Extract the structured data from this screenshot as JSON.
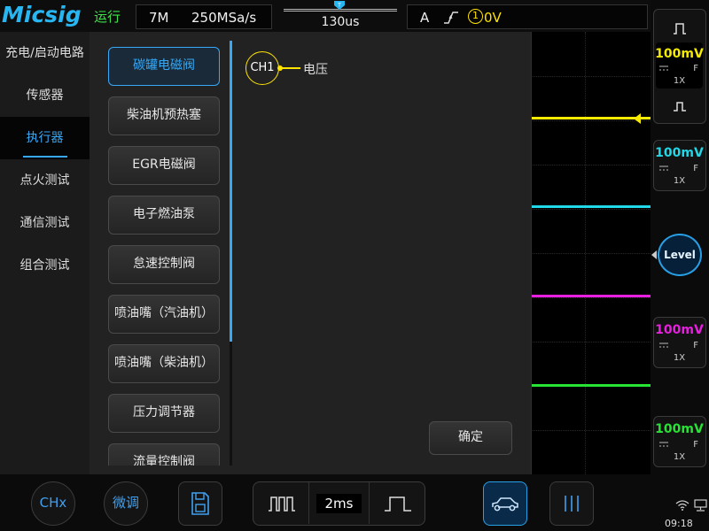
{
  "header": {
    "logo": "Micsig",
    "run_status": "运行",
    "memory_depth": "7M",
    "sample_rate": "250MSa/s",
    "trigger_delay": "130us",
    "trigger_mode": "A",
    "trigger_source": "1",
    "trigger_level": "0V",
    "trigger_edge_icon": "rising-edge-icon"
  },
  "channels": [
    {
      "id": "CH1",
      "scale": "100mV",
      "coupling": "DC",
      "bw": "F",
      "probe": "1X",
      "color": "#f5ea00"
    },
    {
      "id": "CH2",
      "scale": "100mV",
      "coupling": "DC",
      "bw": "F",
      "probe": "1X",
      "color": "#21d8e8"
    },
    {
      "id": "CH3",
      "scale": "100mV",
      "coupling": "DC",
      "bw": "F",
      "probe": "1X",
      "color": "#e81ee0"
    },
    {
      "id": "CH4",
      "scale": "100mV",
      "coupling": "DC",
      "bw": "F",
      "probe": "1X",
      "color": "#27e334"
    }
  ],
  "level_button": "Level",
  "dialog": {
    "categories": [
      "充电/启动电路",
      "传感器",
      "执行器",
      "点火测试",
      "通信测试",
      "组合测试"
    ],
    "active_category": "执行器",
    "items": [
      "碳罐电磁阀",
      "柴油机预热塞",
      "EGR电磁阀",
      "电子燃油泵",
      "怠速控制阀",
      "喷油嘴（汽油机）",
      "喷油嘴（柴油机）",
      "压力调节器",
      "流量控制阀"
    ],
    "active_item": "碳罐电磁阀",
    "detail": {
      "channel": "CH1",
      "signal": "电压"
    },
    "confirm_label": "确定"
  },
  "bottom": {
    "chx_label": "CHx",
    "fine_label": "微调",
    "timebase": "2ms",
    "save_icon": "save-icon",
    "car_icon": "car-icon",
    "cursor_icon": "cursor-icon"
  },
  "status": {
    "clock": "09:18",
    "wifi_icon": "wifi-icon",
    "lan_icon": "lan-icon"
  },
  "colors": {
    "accent": "#36a8f5",
    "trigger": "#ffe400",
    "run": "#3fe24a"
  }
}
